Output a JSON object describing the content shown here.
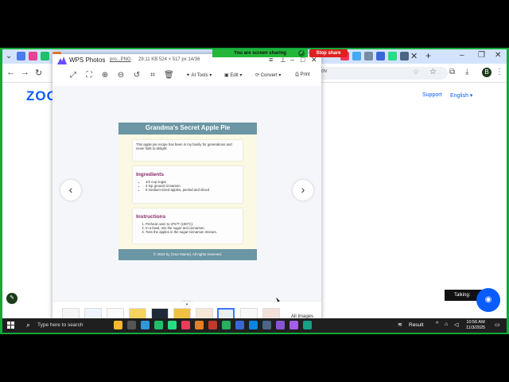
{
  "sharing": {
    "banner": "You are screen sharing",
    "stop_label": "Stop share"
  },
  "browser": {
    "window_controls": [
      "–",
      "❐",
      "✕"
    ],
    "tab_close": "✕",
    "new_tab": "+",
    "site": {
      "logo_text": "ZOO",
      "support_link": "Support",
      "language_link": "English ▾"
    },
    "address_hint": "/ov",
    "profile_letter": "B"
  },
  "wps": {
    "app_name": "WPS Photos",
    "file_name": "pro...PNG",
    "file_meta": "29.11 KB  524 × 517 px 14/36",
    "toolbar": {
      "ai_tools": "AI Tools",
      "edit": "Edit",
      "convert": "Convert",
      "print": "Print"
    },
    "all_images": "All Images"
  },
  "recipe": {
    "title": "Grandma's Secret Apple Pie",
    "intro": "This apple pie recipe has been in my family for generations and never fails to delight.",
    "ingredients_heading": "Ingredients",
    "ingredients": [
      "1/2 cup sugar",
      "2 tsp ground cinnamon",
      "6 medium-sized apples, peeled and sliced"
    ],
    "instructions_heading": "Instructions",
    "instructions": [
      "Preheat oven to 375°F (190°C).",
      "In a bowl, mix the sugar and cinnamon.",
      "Toss the apples in the sugar-cinnamon mixture."
    ],
    "footer": "© 2023 by [Your Name]. All rights reserved."
  },
  "widgets": {
    "talking": "Talking:"
  },
  "taskbar": {
    "search_placeholder": "Type here to search",
    "result_label": "Result",
    "time": "10:56 AM",
    "date": "11/3/2025"
  },
  "colors": {
    "share_green": "#23b83a",
    "stop_red": "#e02020",
    "recipe_header": "#6b96a3",
    "recipe_heading": "#8a2a6a",
    "zoom_blue": "#0b5cff"
  }
}
